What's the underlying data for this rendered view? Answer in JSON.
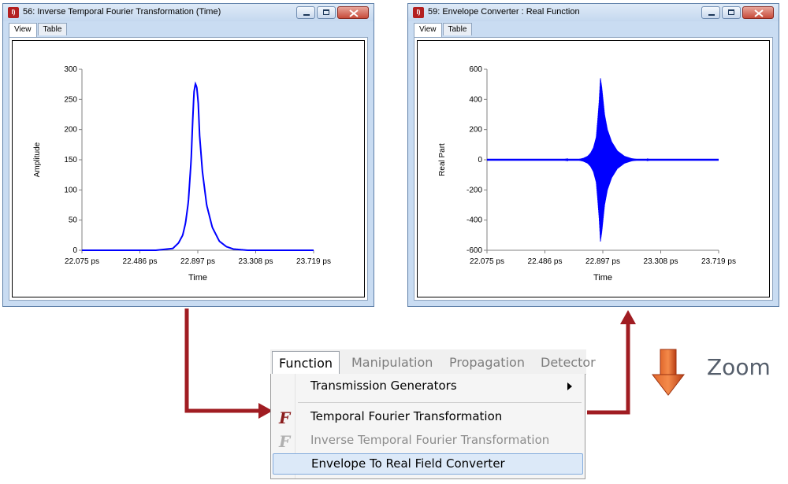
{
  "windows": [
    {
      "title": "56: Inverse Temporal Fourier Transformation (Time)",
      "app_icon": "I)",
      "tabs": [
        "View",
        "Table"
      ],
      "active_tab": "View"
    },
    {
      "title": "59: Envelope Converter : Real Function",
      "app_icon": "I)",
      "tabs": [
        "View",
        "Table"
      ],
      "active_tab": "View"
    }
  ],
  "menu": {
    "bar": [
      "Function",
      "Manipulation",
      "Propagation",
      "Detector"
    ],
    "active": "Function",
    "items": [
      {
        "label": "Transmission Generators",
        "icon": "",
        "submenu": true,
        "disabled": false
      },
      {
        "label": "Temporal Fourier Transformation",
        "icon": "F",
        "submenu": false,
        "disabled": false
      },
      {
        "label": "Inverse Temporal Fourier Transformation",
        "icon": "F",
        "submenu": false,
        "disabled": true
      },
      {
        "label": "Envelope To Real Field Converter",
        "icon": "",
        "submenu": false,
        "disabled": false,
        "selected": true
      }
    ]
  },
  "zoom_label": "Zoom",
  "colors": {
    "arrow": "#a01c22",
    "series": "#0000ff",
    "zoom_arrow": "#c8471c"
  },
  "chart_data": [
    {
      "type": "line",
      "title": "",
      "xlabel": "Time",
      "ylabel": "Amplitude",
      "x_ticks": [
        "22.075 ps",
        "22.486 ps",
        "22.897 ps",
        "23.308 ps",
        "23.719 ps"
      ],
      "y_ticks": [
        "0",
        "50",
        "100",
        "150",
        "200",
        "250",
        "300"
      ],
      "xlim": [
        22.075,
        23.719
      ],
      "ylim": [
        0,
        300
      ],
      "grid": false,
      "series": [
        {
          "x": [
            22.075,
            22.6,
            22.72,
            22.76,
            22.79,
            22.81,
            22.83,
            22.85,
            22.86,
            22.87,
            22.88,
            22.89,
            22.9,
            22.91,
            22.93,
            22.96,
            23.0,
            23.05,
            23.1,
            23.15,
            23.25,
            23.719
          ],
          "y": [
            0,
            0,
            3,
            12,
            25,
            45,
            80,
            150,
            210,
            262,
            276,
            270,
            245,
            190,
            130,
            75,
            38,
            15,
            6,
            2,
            0,
            0
          ]
        }
      ]
    },
    {
      "type": "line",
      "title": "",
      "xlabel": "Time",
      "ylabel": "Real Part",
      "x_ticks": [
        "22.075 ps",
        "22.486 ps",
        "22.897 ps",
        "23.308 ps",
        "23.719 ps"
      ],
      "y_ticks": [
        "-600",
        "-400",
        "-200",
        "0",
        "200",
        "400",
        "600"
      ],
      "xlim": [
        22.075,
        23.719
      ],
      "ylim": [
        -600,
        600
      ],
      "grid": false,
      "series": [
        {
          "x": [
            22.075,
            22.6,
            22.72,
            22.76,
            22.79,
            22.81,
            22.83,
            22.85,
            22.86,
            22.87,
            22.88,
            22.89,
            22.9,
            22.91,
            22.93,
            22.96,
            23.0,
            23.05,
            23.1,
            23.15,
            23.25,
            23.719
          ],
          "envelope": [
            0,
            0,
            3,
            12,
            25,
            45,
            80,
            150,
            260,
            380,
            545,
            480,
            390,
            300,
            200,
            120,
            60,
            25,
            10,
            3,
            0,
            0
          ]
        }
      ]
    }
  ]
}
